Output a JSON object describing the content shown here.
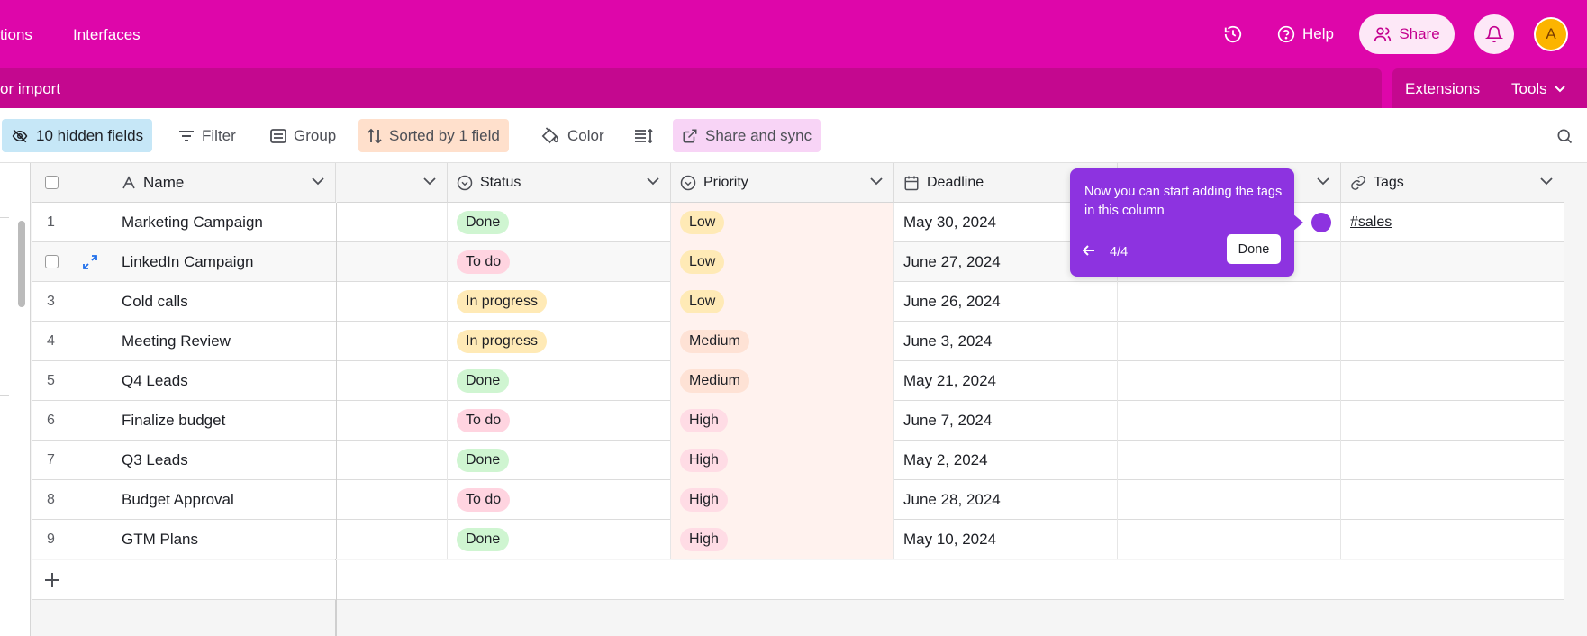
{
  "topbar": {
    "nav_partial": "tions",
    "nav_interfaces": "Interfaces",
    "help_label": "Help",
    "share_label": "Share",
    "avatar_initial": "A",
    "bg_color": "#de06aa"
  },
  "secondbar": {
    "import_partial": "or import",
    "extensions_label": "Extensions",
    "tools_label": "Tools"
  },
  "toolbar": {
    "hidden_fields": "10 hidden fields",
    "filter": "Filter",
    "group": "Group",
    "sorted": "Sorted by 1 field",
    "color": "Color",
    "share_sync": "Share and sync"
  },
  "columns": {
    "name": "Name",
    "status": "Status",
    "priority": "Priority",
    "deadline": "Deadline",
    "tags": "Tags"
  },
  "rows": [
    {
      "num": "1",
      "name": "Marketing Campaign",
      "status": "Done",
      "priority": "Low",
      "deadline": "May 30, 2024",
      "tags": "#sales"
    },
    {
      "num": "",
      "name": "LinkedIn Campaign",
      "status": "To do",
      "priority": "Low",
      "deadline": "June 27, 2024",
      "tags": ""
    },
    {
      "num": "3",
      "name": "Cold calls",
      "status": "In progress",
      "priority": "Low",
      "deadline": "June 26, 2024",
      "tags": ""
    },
    {
      "num": "4",
      "name": "Meeting Review",
      "status": "In progress",
      "priority": "Medium",
      "deadline": "June 3, 2024",
      "tags": ""
    },
    {
      "num": "5",
      "name": "Q4 Leads",
      "status": "Done",
      "priority": "Medium",
      "deadline": "May 21, 2024",
      "tags": ""
    },
    {
      "num": "6",
      "name": "Finalize budget",
      "status": "To do",
      "priority": "High",
      "deadline": "June 7, 2024",
      "tags": ""
    },
    {
      "num": "7",
      "name": "Q3 Leads",
      "status": "Done",
      "priority": "High",
      "deadline": "May 2, 2024",
      "tags": ""
    },
    {
      "num": "8",
      "name": "Budget Approval",
      "status": "To do",
      "priority": "High",
      "deadline": "June 28, 2024",
      "tags": ""
    },
    {
      "num": "9",
      "name": "GTM Plans",
      "status": "Done",
      "priority": "High",
      "deadline": "May 10, 2024",
      "tags": ""
    }
  ],
  "status_colors": {
    "Done": "#cff5d1",
    "To do": "#ffd4e0",
    "In progress": "#ffeab6"
  },
  "priority_colors": {
    "Low": "#ffeab6",
    "Medium": "#fee2d5",
    "High": "#ffdce5"
  },
  "tooltip": {
    "message": "Now you can start adding the tags in this column",
    "progress": "4/4",
    "done_label": "Done",
    "color": "#8d33e0"
  },
  "icons": {
    "history": "history-icon",
    "help": "help-circle-icon",
    "share": "users-icon",
    "bell": "bell-icon",
    "search": "search-icon",
    "expand": "expand-icon",
    "add": "plus-icon"
  }
}
